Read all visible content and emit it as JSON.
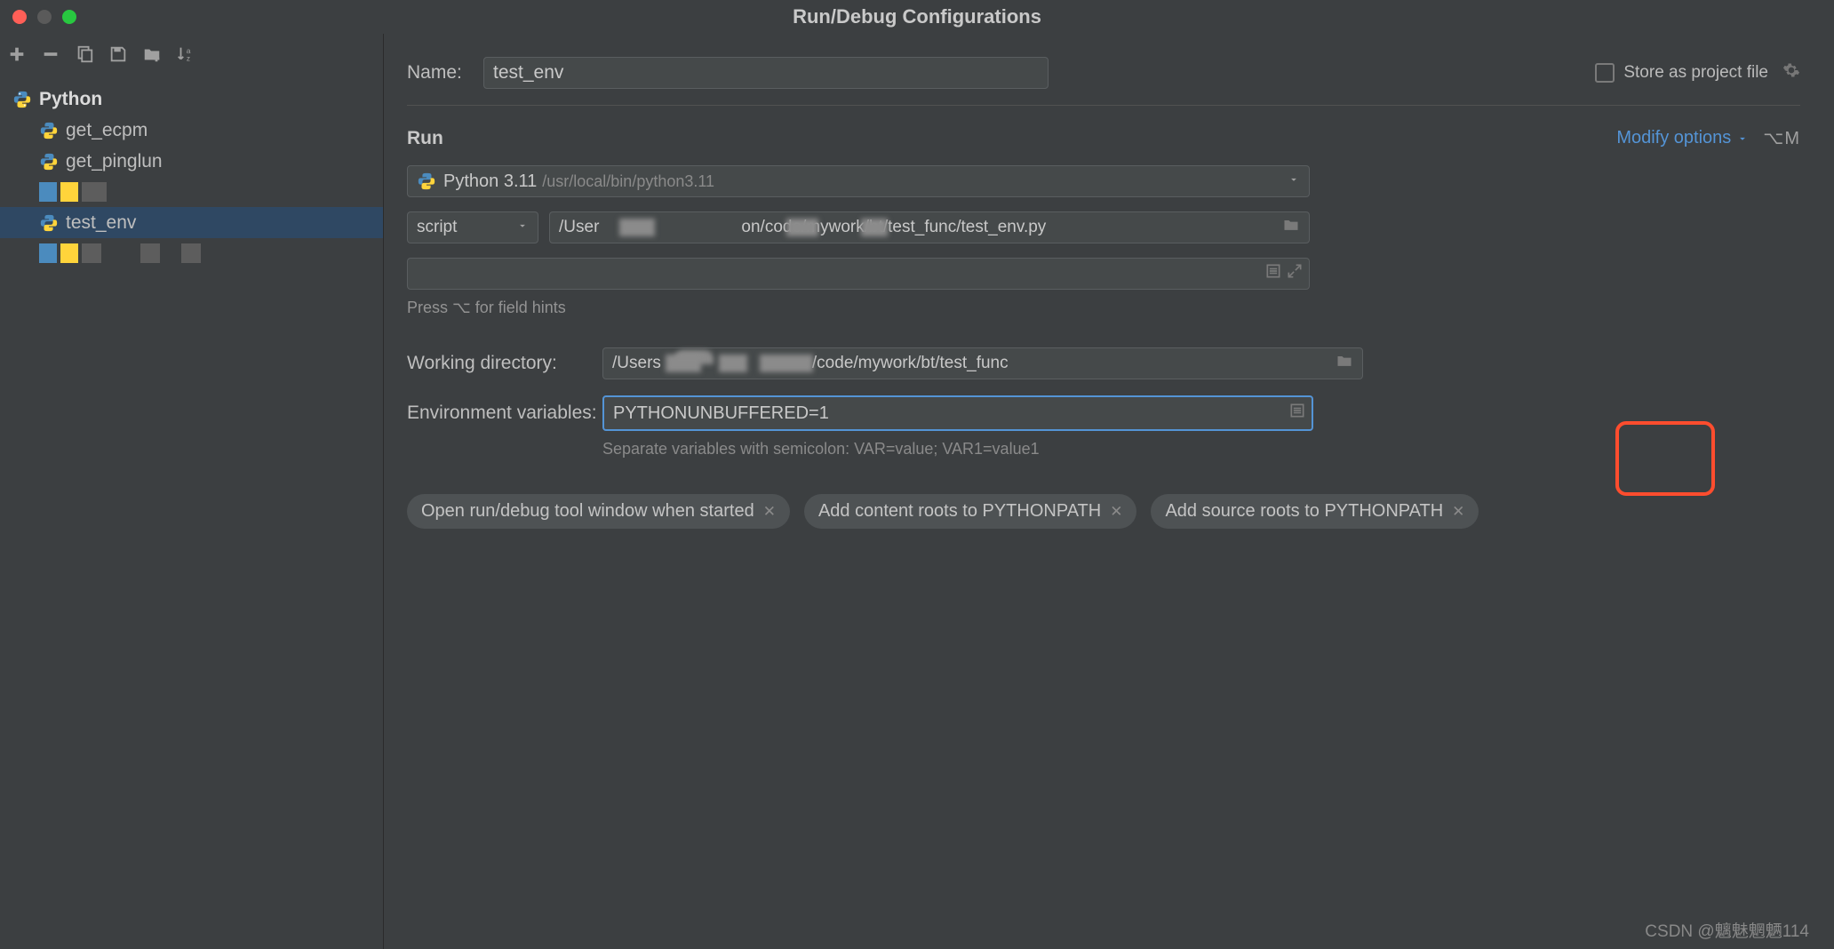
{
  "title": "Run/Debug Configurations",
  "sidebar": {
    "root_label": "Python",
    "items": [
      {
        "label": "get_ecpm"
      },
      {
        "label": "get_pinglun"
      },
      {
        "label": ""
      },
      {
        "label": "test_env",
        "selected": true
      },
      {
        "label": ""
      }
    ]
  },
  "form": {
    "name_label": "Name:",
    "name_value": "test_env",
    "store_label": "Store as project file"
  },
  "run": {
    "section_title": "Run",
    "modify_label": "Modify options",
    "shortcut": "⌥M",
    "interpreter_name": "Python 3.11",
    "interpreter_path": "/usr/local/bin/python3.11",
    "script_mode": "script",
    "script_path_prefix": "/User",
    "script_path_suffix": "on/code/mywork/bt/test_func/test_env.py",
    "hint": "Press ⌥ for field hints",
    "wd_label": "Working directory:",
    "wd_prefix": "/Users",
    "wd_suffix": "/code/mywork/bt/test_func",
    "env_label": "Environment variables:",
    "env_value": "PYTHONUNBUFFERED=1",
    "env_hint": "Separate variables with semicolon: VAR=value; VAR1=value1"
  },
  "chips": [
    "Open run/debug tool window when started",
    "Add content roots to PYTHONPATH",
    "Add source roots to PYTHONPATH"
  ],
  "watermark": "CSDN @魑魅魍魉114"
}
